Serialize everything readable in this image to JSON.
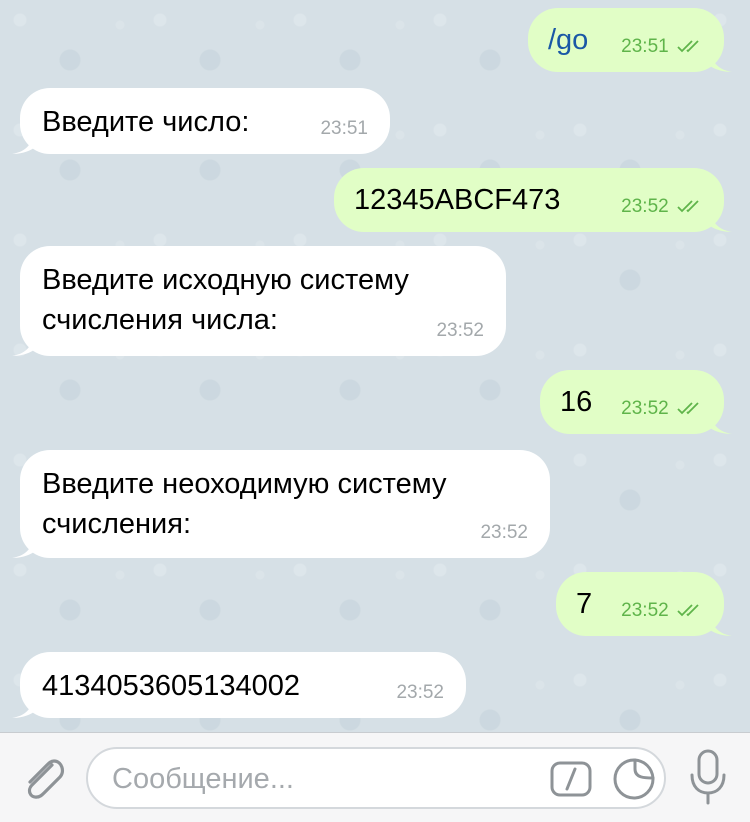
{
  "messages": [
    {
      "side": "out",
      "text": "/go",
      "time": "23:51",
      "read": true
    },
    {
      "side": "in",
      "text": "Введите число:",
      "time": "23:51"
    },
    {
      "side": "out",
      "text": "12345ABCF473",
      "time": "23:52",
      "read": true
    },
    {
      "side": "in",
      "lines": [
        "Введите исходную систему",
        "счисления числа:"
      ],
      "time": "23:52"
    },
    {
      "side": "out",
      "text": "16",
      "time": "23:52",
      "read": true
    },
    {
      "side": "in",
      "lines": [
        "Введите неоходимую систему",
        "счисления:"
      ],
      "time": "23:52"
    },
    {
      "side": "out",
      "text": "7",
      "time": "23:52",
      "read": true
    },
    {
      "side": "in",
      "text": "4134053605134002",
      "time": "23:52"
    }
  ],
  "composer": {
    "placeholder": "Сообщение..."
  },
  "icons": {
    "attach": "paperclip-icon",
    "command": "slash-command-icon",
    "sticker": "sticker-icon",
    "mic": "microphone-icon"
  },
  "colors": {
    "incoming_bubble": "#ffffff",
    "outgoing_bubble": "#e1fec6",
    "read_check": "#5fb44a",
    "command_link": "#1a58a6"
  }
}
